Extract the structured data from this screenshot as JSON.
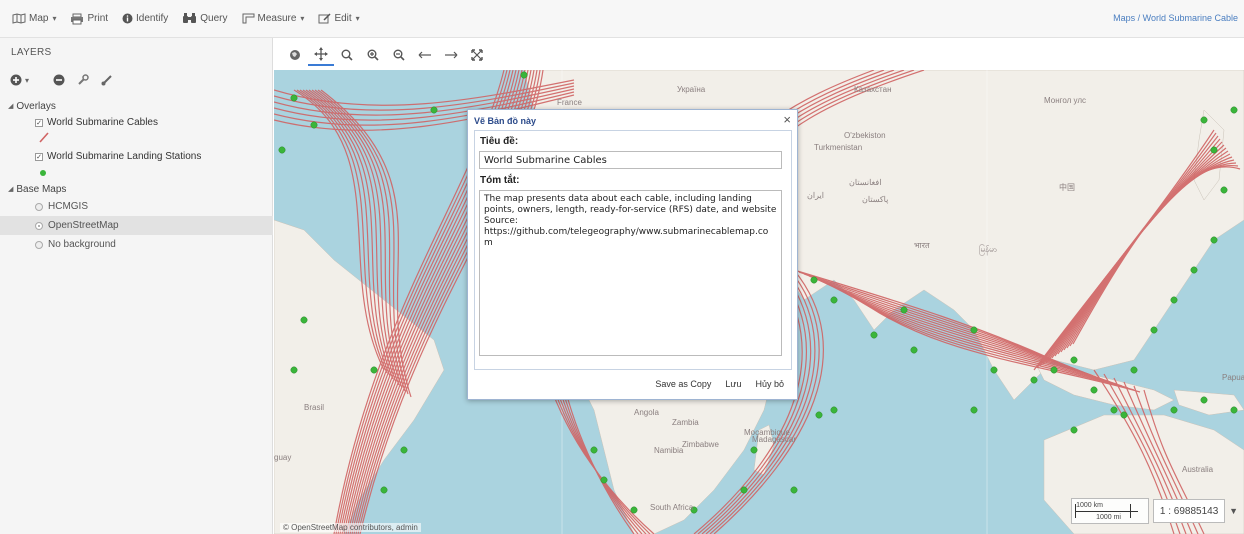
{
  "toolbar": {
    "map_label": "Map",
    "print_label": "Print",
    "identify_label": "Identify",
    "query_label": "Query",
    "measure_label": "Measure",
    "edit_label": "Edit",
    "breadcrumb": "Maps / World Submarine Cable"
  },
  "sidebar": {
    "title": "LAYERS",
    "overlays_label": "Overlays",
    "overlays": [
      {
        "label": "World Submarine Cables",
        "checked": true
      },
      {
        "label": "World Submarine Landing Stations",
        "checked": true
      }
    ],
    "basemaps_label": "Base Maps",
    "basemaps": [
      {
        "label": "HCMGIS",
        "selected": false
      },
      {
        "label": "OpenStreetMap",
        "selected": true
      },
      {
        "label": "No background",
        "selected": false
      }
    ]
  },
  "map": {
    "labels": [
      "France",
      "Україна",
      "Казахстан",
      "Монгол улс",
      "O'zbekiston",
      "Turkmenistan",
      "ایران",
      "افغانستان",
      "پاکستان",
      "中国",
      "भारत",
      "မြန်မာ",
      "Brasil",
      "Angola",
      "Zambia",
      "Moçambique",
      "Zimbabwe",
      "Namibia",
      "Madagascar",
      "South Africa",
      "Australia",
      "Papua",
      "guay"
    ],
    "attribution": "© OpenStreetMap contributors, admin",
    "scale_km": "1000 km",
    "scale_mi": "1000 mi",
    "scale_value": "1 : 69885143"
  },
  "dialog": {
    "title": "Vẽ Bản đồ này",
    "close": "×",
    "title_label": "Tiêu đề:",
    "title_value": "World Submarine Cables",
    "summary_label": "Tóm tắt:",
    "summary_value": "The map presents data about each cable, including landing points, owners, length, ready-for-service (RFS) date, and website\nSource:\nhttps://github.com/telegeography/www.submarinecablemap.com",
    "save_copy_label": "Save as Copy",
    "save_label": "Lưu",
    "cancel_label": "Hủy bỏ"
  },
  "colors": {
    "cable": "#d06464",
    "station": "#3ab53a",
    "water": "#aad3df",
    "land": "#f2efe9"
  }
}
